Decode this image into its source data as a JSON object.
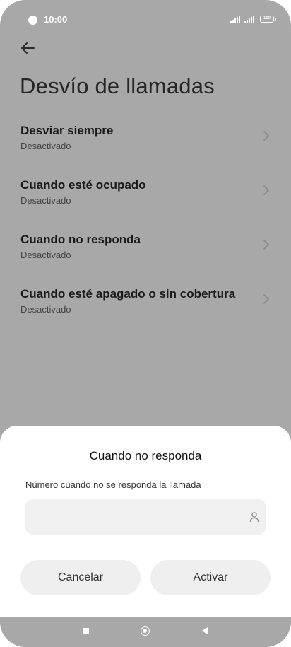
{
  "status_bar": {
    "time": "10:00",
    "battery": "100"
  },
  "header": {
    "title": "Desvío de llamadas",
    "icons": {
      "back": "back-arrow-icon"
    }
  },
  "list": {
    "items": [
      {
        "title": "Desviar siempre",
        "status": "Desactivado"
      },
      {
        "title": "Cuando esté ocupado",
        "status": "Desactivado"
      },
      {
        "title": "Cuando no responda",
        "status": "Desactivado"
      },
      {
        "title": "Cuando esté apagado o sin cobertura",
        "status": "Desactivado"
      }
    ]
  },
  "dialog": {
    "title": "Cuando no responda",
    "field_label": "Número cuando no se responda la llamada",
    "field_value": "",
    "cancel_label": "Cancelar",
    "activate_label": "Activar"
  },
  "colors": {
    "overlay": "#a8a8a8",
    "sheet": "#ffffff",
    "button": "#efefef"
  }
}
